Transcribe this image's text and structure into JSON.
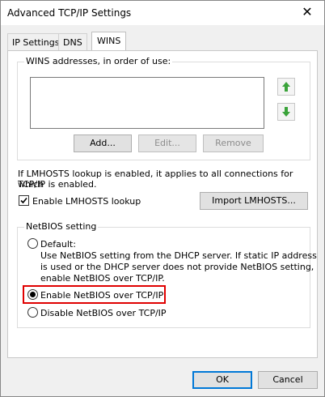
{
  "window": {
    "title": "Advanced TCP/IP Settings",
    "close_glyph": "✕"
  },
  "tabs": [
    {
      "label": "IP Settings",
      "active": false
    },
    {
      "label": "DNS",
      "active": false
    },
    {
      "label": "WINS",
      "active": true
    }
  ],
  "wins": {
    "group_label": "WINS addresses, in order of use:",
    "add_label": "Add...",
    "edit_label": "Edit...",
    "remove_label": "Remove"
  },
  "lmhosts": {
    "info_text_line1": "If LMHOSTS lookup is enabled, it applies to all connections for which",
    "info_text_line2": "TCP/IP is enabled.",
    "checkbox_label": "Enable LMHOSTS lookup",
    "checked": true,
    "import_label": "Import LMHOSTS..."
  },
  "netbios": {
    "group_label": "NetBIOS setting",
    "options": [
      {
        "label": "Default:",
        "selected": false
      },
      {
        "label": "Enable NetBIOS over TCP/IP",
        "selected": true
      },
      {
        "label": "Disable NetBIOS over TCP/IP",
        "selected": false
      }
    ],
    "default_desc_line1": "Use NetBIOS setting from the DHCP server. If static IP address",
    "default_desc_line2": "is used or the DHCP server does not provide NetBIOS setting,",
    "default_desc_line3": "enable NetBIOS over TCP/IP."
  },
  "footer": {
    "ok_label": "OK",
    "cancel_label": "Cancel"
  },
  "colors": {
    "arrow_green": "#3aa33a",
    "highlight": "#e00000",
    "accent": "#0078d7"
  }
}
